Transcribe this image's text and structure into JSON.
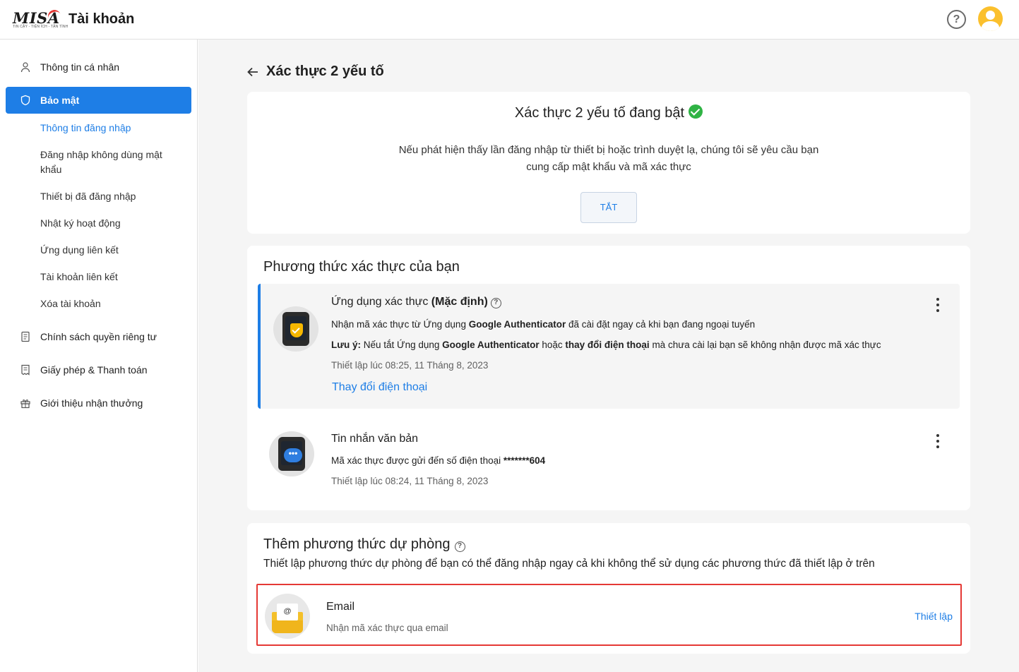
{
  "header": {
    "logo_text": "MISA",
    "logo_tagline": "TIN CẬY - TIỆN ÍCH - TẬN TÌNH",
    "app_title": "Tài khoản",
    "help_symbol": "?"
  },
  "sidebar": {
    "items": [
      {
        "label": "Thông tin cá nhân",
        "icon": "person-icon"
      },
      {
        "label": "Bảo mật",
        "icon": "shield-icon",
        "active": true
      },
      {
        "label": "Chính sách quyền riêng tư",
        "icon": "document-icon"
      },
      {
        "label": "Giấy phép & Thanh toán",
        "icon": "receipt-icon"
      },
      {
        "label": "Giới thiệu nhận thưởng",
        "icon": "gift-icon"
      }
    ],
    "sub_items": [
      {
        "label": "Thông tin đăng nhập",
        "active": true
      },
      {
        "label": "Đăng nhập không dùng mật khẩu"
      },
      {
        "label": "Thiết bị đã đăng nhập"
      },
      {
        "label": "Nhật ký hoạt động"
      },
      {
        "label": "Ứng dụng liên kết"
      },
      {
        "label": "Tài khoản liên kết"
      },
      {
        "label": "Xóa tài khoản"
      }
    ]
  },
  "page": {
    "title": "Xác thực 2 yếu tố"
  },
  "status": {
    "title": "Xác thực 2 yếu tố đang bật",
    "description": "Nếu phát hiện thấy lần đăng nhập từ thiết bị hoặc trình duyệt lạ, chúng tôi sẽ yêu cầu bạn cung cấp mật khẩu và mã xác thực",
    "off_button": "TẮT"
  },
  "methods": {
    "title": "Phương thức xác thực của bạn",
    "authenticator": {
      "title": "Ứng dụng xác thực",
      "default_tag": "(Mặc định)",
      "line1_pre": "Nhận mã xác thực từ Ứng dụng ",
      "line1_bold": "Google Authenticator",
      "line1_post": " đã cài đặt ngay cả khi bạn đang ngoại tuyến",
      "note_label": "Lưu ý:",
      "note_pre": " Nếu tắt Ứng dụng ",
      "note_bold1": "Google Authenticator",
      "note_mid": " hoặc ",
      "note_bold2": "thay đổi điện thoại",
      "note_post": " mà chưa cài lại bạn sẽ không nhận được mã xác thực",
      "setup_time": "Thiết lập lúc 08:25, 11 Tháng 8, 2023",
      "change_phone_link": "Thay đổi điện thoại"
    },
    "sms": {
      "title": "Tin nhắn văn bản",
      "line_pre": "Mã xác thực được gửi đến số điện thoại ",
      "phone_masked": "*******604",
      "setup_time": "Thiết lập lúc 08:24, 11 Tháng 8, 2023",
      "bubble": "•••"
    }
  },
  "backup": {
    "title": "Thêm phương thức dự phòng",
    "description": "Thiết lập phương thức dự phòng để bạn có thể đăng nhập ngay cả khi không thể sử dụng các phương thức đã thiết lập ở trên",
    "email": {
      "title": "Email",
      "description": "Nhận mã xác thực qua email",
      "setup_link": "Thiết lập",
      "at_symbol": "@"
    }
  },
  "colors": {
    "accent": "#1e7ee6",
    "success": "#2fb344",
    "highlight_border": "#e53935",
    "avatar": "#fbc02d"
  }
}
